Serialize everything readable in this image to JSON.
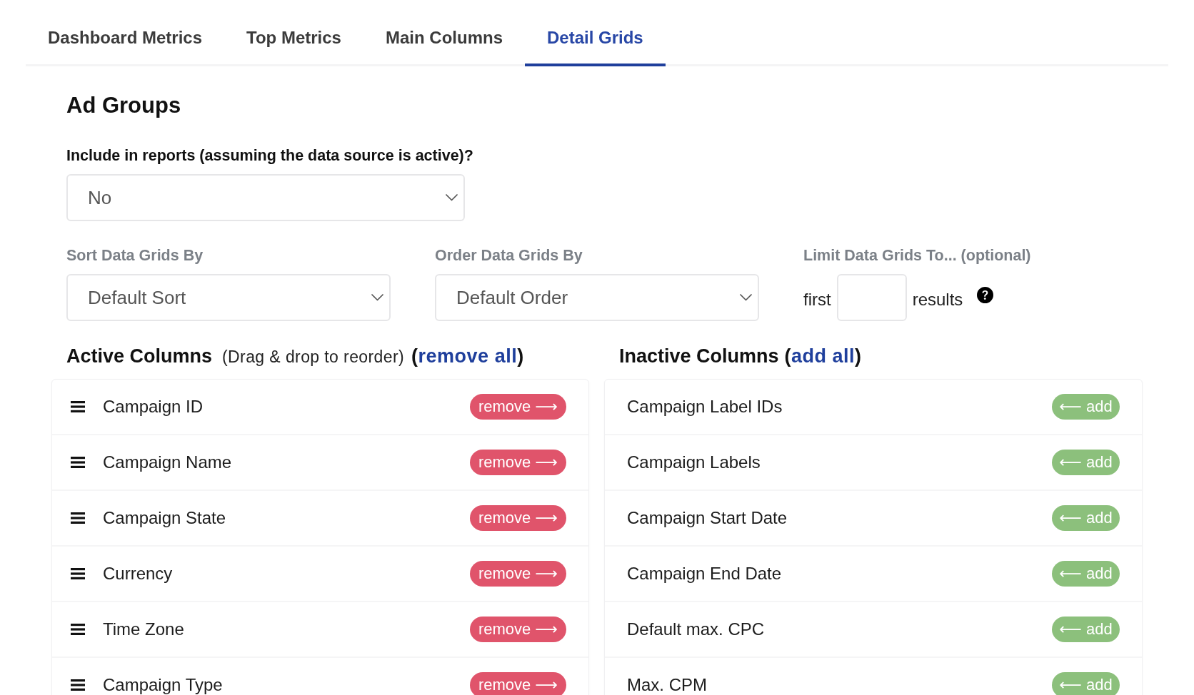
{
  "tabs": [
    {
      "label": "Dashboard Metrics",
      "selected": false
    },
    {
      "label": "Top Metrics",
      "selected": false
    },
    {
      "label": "Main Columns",
      "selected": false
    },
    {
      "label": "Detail Grids",
      "selected": true
    }
  ],
  "section": {
    "title": "Ad Groups",
    "include": {
      "label": "Include in reports (assuming the data source is active)?",
      "value": "No"
    },
    "sort": {
      "label": "Sort Data Grids By",
      "value": "Default Sort"
    },
    "order": {
      "label": "Order Data Grids By",
      "value": "Default Order"
    },
    "limit": {
      "label": "Limit Data Grids To... (optional)",
      "prefix": "first",
      "suffix": "results"
    }
  },
  "active_columns": {
    "title": "Active Columns",
    "hint": "(Drag & drop to reorder)",
    "action": {
      "prefix": "(",
      "link": "remove all",
      "suffix": ")"
    },
    "items": [
      {
        "name": "Campaign ID",
        "button": "remove ⟶"
      },
      {
        "name": "Campaign Name",
        "button": "remove ⟶"
      },
      {
        "name": "Campaign State",
        "button": "remove ⟶"
      },
      {
        "name": "Currency",
        "button": "remove ⟶"
      },
      {
        "name": "Time Zone",
        "button": "remove ⟶"
      },
      {
        "name": "Campaign Type",
        "button": "remove ⟶"
      }
    ]
  },
  "inactive_columns": {
    "title": "Inactive Columns",
    "action": {
      "prefix": "(",
      "link": "add all",
      "suffix": ")"
    },
    "items": [
      {
        "name": "Campaign Label IDs",
        "button": "⟵ add"
      },
      {
        "name": "Campaign Labels",
        "button": "⟵ add"
      },
      {
        "name": "Campaign Start Date",
        "button": "⟵ add"
      },
      {
        "name": "Campaign End Date",
        "button": "⟵ add"
      },
      {
        "name": "Default max. CPC",
        "button": "⟵ add"
      },
      {
        "name": "Max. CPM",
        "button": "⟵ add"
      }
    ]
  }
}
